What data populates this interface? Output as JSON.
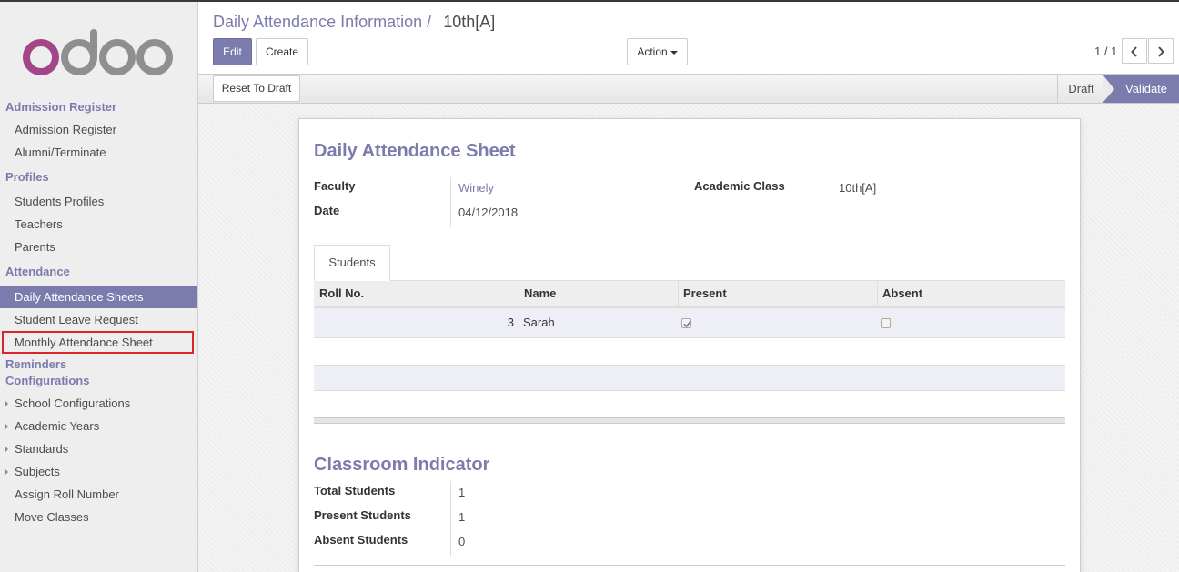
{
  "brand": {
    "logo_text": "odoo",
    "colors": {
      "o_purple": "#a24689",
      "o_gray": "#8f8f8f",
      "accent": "#7c7bad"
    }
  },
  "sidebar": {
    "sections": [
      {
        "title": "Admission Register",
        "items": [
          "Admission Register",
          "Alumni/Terminate"
        ]
      },
      {
        "title": "Profiles",
        "items": [
          "Students Profiles",
          "Teachers",
          "Parents"
        ]
      },
      {
        "title": "Attendance",
        "items": [
          "Daily Attendance Sheets",
          "Student Leave Request",
          "Monthly Attendance Sheet"
        ]
      },
      {
        "title": "Reminders",
        "items": []
      },
      {
        "title": "Configurations",
        "items": [
          "School Configurations",
          "Academic Years",
          "Standards",
          "Subjects",
          "Assign Roll Number",
          "Move Classes"
        ]
      }
    ],
    "active_item": "Daily Attendance Sheets",
    "highlighted_item": "Monthly Attendance Sheet"
  },
  "breadcrumb": {
    "parent": "Daily Attendance Information",
    "separator": "/",
    "current": "10th[A]"
  },
  "buttons": {
    "edit": "Edit",
    "create": "Create",
    "action": "Action",
    "reset_to_draft": "Reset To Draft"
  },
  "pager": {
    "value": "1 / 1"
  },
  "status": {
    "stages": [
      "Draft",
      "Validate"
    ],
    "current": "Validate"
  },
  "form": {
    "title": "Daily Attendance Sheet",
    "fields": {
      "faculty_label": "Faculty",
      "faculty_value": "Winely",
      "date_label": "Date",
      "date_value": "04/12/2018",
      "class_label": "Academic Class",
      "class_value": "10th[A]"
    },
    "tab": "Students",
    "table": {
      "headers": [
        "Roll No.",
        "Name",
        "Present",
        "Absent"
      ],
      "rows": [
        {
          "roll_no": "3",
          "name": "Sarah",
          "present": true,
          "absent": false
        }
      ]
    },
    "indicator": {
      "title": "Classroom Indicator",
      "total_label": "Total Students",
      "total_value": "1",
      "present_label": "Present Students",
      "present_value": "1",
      "absent_label": "Absent Students",
      "absent_value": "0"
    }
  }
}
